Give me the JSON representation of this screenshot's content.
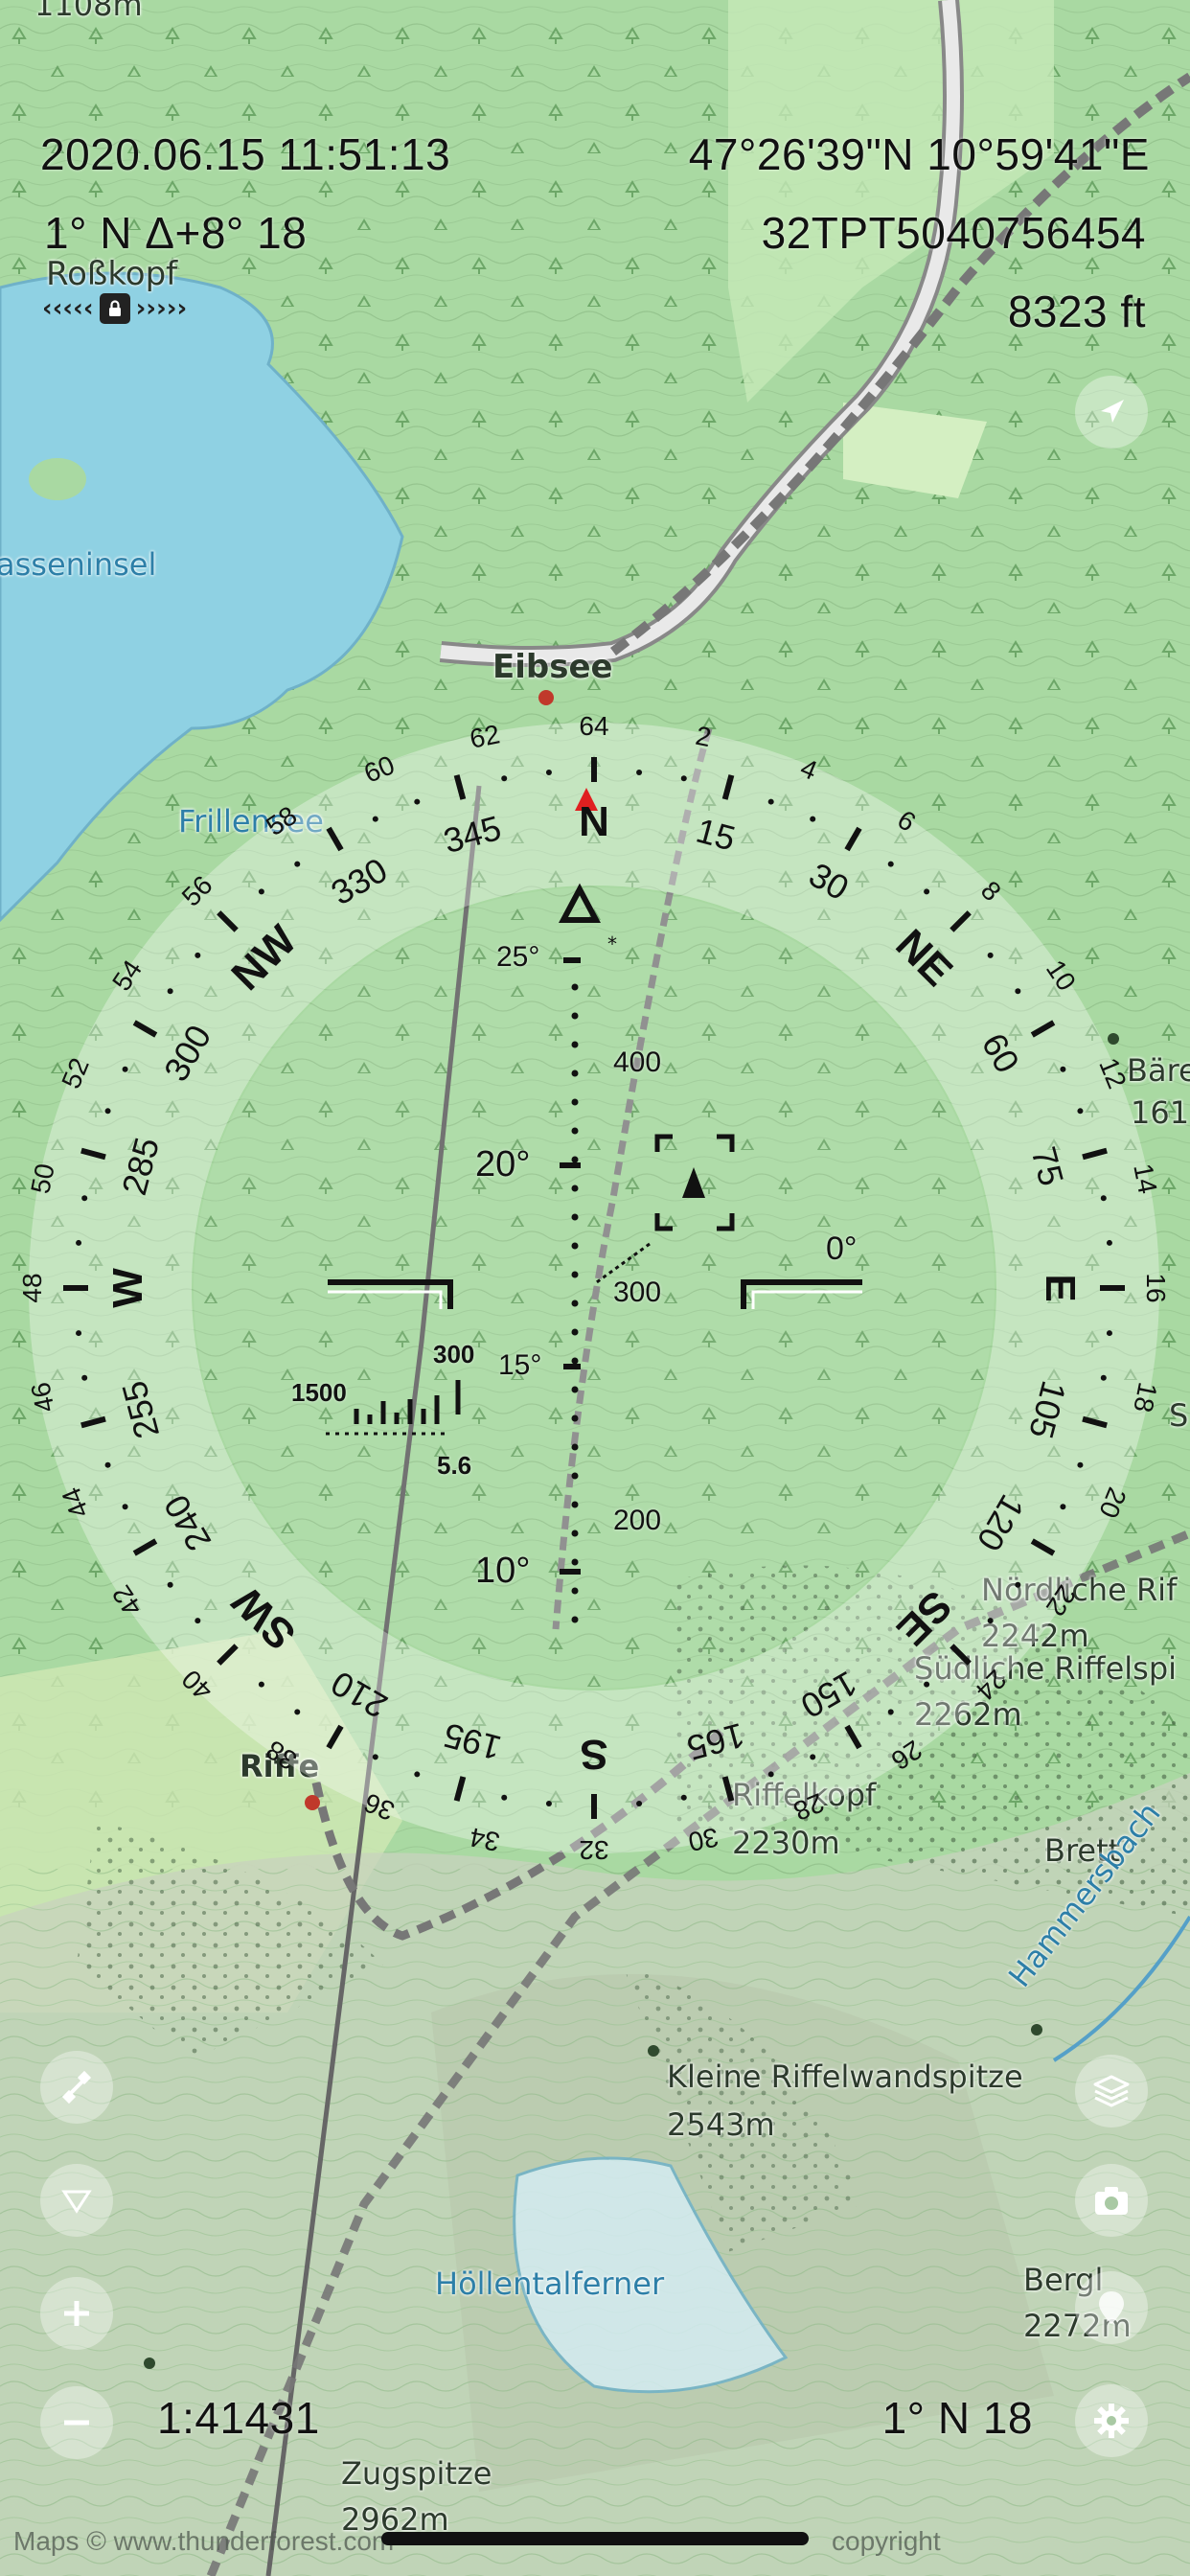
{
  "hud": {
    "datetime": "2020.06.15 11:51:13",
    "coordinates": "47°26'39\"N 10°59'41\"E",
    "heading_info": "1° N Δ+8° 18",
    "grid_ref": "32TPT5040756454",
    "altitude": "8323 ft",
    "target_name": "Roßkopf",
    "scale": "1:41431",
    "bottom_heading": "1° N 18"
  },
  "map_labels": {
    "top_left": "1108m",
    "lake_island": "asseninsel",
    "eibsee": "Eibsee",
    "frillensee": "Frillensee",
    "riffe": "Riffe",
    "bare": "Bäre",
    "bare_alt": "161",
    "nordliche": "Nördliche Rif",
    "nordliche_alt": "2242m",
    "sudliche": "Südliche Riffelspi",
    "sudliche_alt": "2262m",
    "riffelkopf": "Riffelkopf",
    "riffelkopf_alt": "2230m",
    "brett": "Brett",
    "hammersbach": "Hammersbach",
    "kleine": "Kleine Riffelwandspitze",
    "kleine_alt": "2543m",
    "hollental": "Höllentalferner",
    "bergl": "Bergl",
    "bergl_alt": "2272m",
    "zugspitze": "Zugspitze",
    "zugspitze_alt": "2962m",
    "s_edge": "S",
    "attribution_left": "Maps © www.thunderforest.com",
    "attribution_right": "copyright"
  },
  "compass": {
    "cardinals": [
      "N",
      "NE",
      "E",
      "SE",
      "S",
      "SW",
      "W",
      "NW"
    ],
    "degree_labels": [
      "15",
      "30",
      "60",
      "75",
      "105",
      "120",
      "150",
      "165",
      "195",
      "210",
      "240",
      "255",
      "285",
      "300",
      "330",
      "345"
    ],
    "mil_labels": [
      "2",
      "4",
      "6",
      "8",
      "10",
      "12",
      "14",
      "16",
      "18",
      "20",
      "22",
      "24",
      "26",
      "28",
      "30",
      "32",
      "34",
      "36",
      "38",
      "40",
      "42",
      "44",
      "46",
      "48",
      "50",
      "52",
      "54",
      "56",
      "58",
      "60",
      "62",
      "64"
    ],
    "pitch_labels": [
      "25°",
      "20°",
      "15°",
      "10°"
    ],
    "distance_labels": [
      "400",
      "300",
      "200"
    ],
    "horizon_label": "0°",
    "rangefinder_top": "300",
    "rangefinder_left": "1500",
    "rangefinder_bottom": "5.6"
  },
  "buttons": {
    "locate": "location-arrow-icon",
    "layers": "layers-icon",
    "camera": "camera-icon",
    "waypoint": "waypoint-icon",
    "settings": "gear-icon",
    "compass_mode": "satellite-icon",
    "triangle": "triangle-down-icon",
    "zoom_in": "plus-icon",
    "zoom_out": "minus-icon"
  },
  "colors": {
    "map_green": "#a9d9a2",
    "water": "#8fd1e3",
    "compass_ring": "rgba(255,255,255,0.35)",
    "north_marker": "#e02020"
  }
}
